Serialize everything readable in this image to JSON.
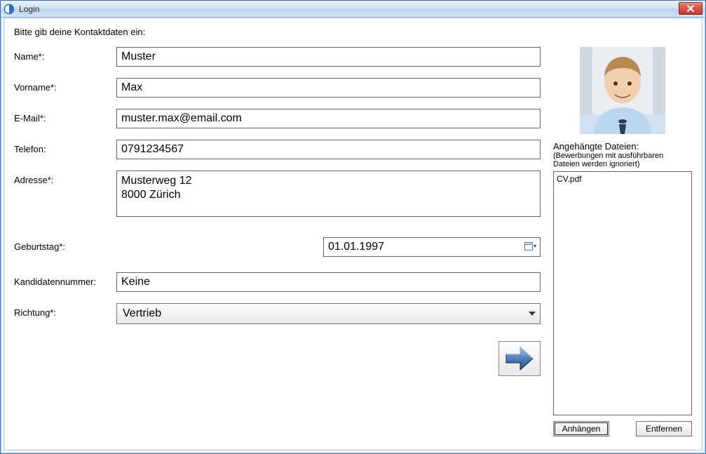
{
  "window": {
    "title": "Login"
  },
  "instruction": "Bitte gib deine Kontaktdaten ein:",
  "labels": {
    "name": "Name*:",
    "vorname": "Vorname*:",
    "email": "E-Mail*:",
    "telefon": "Telefon:",
    "adresse": "Adresse*:",
    "geburtstag": "Geburtstag*:",
    "kandidatennummer": "Kandidatennummer:",
    "richtung": "Richtung*:"
  },
  "values": {
    "name": "Muster",
    "vorname": "Max",
    "email": "muster.max@email.com",
    "telefon": "0791234567",
    "adresse": "Musterweg 12\n8000 Zürich",
    "geburtstag": "01.01.1997",
    "kandidatennummer": "Keine",
    "richtung": "Vertrieb"
  },
  "attachments": {
    "header": "Angehängte Dateien:",
    "note": "(Bewerbungen mit ausführbaren Dateien werden ignoriert)",
    "items": [
      "CV.pdf"
    ],
    "attach_label": "Anhängen",
    "remove_label": "Entfernen"
  }
}
